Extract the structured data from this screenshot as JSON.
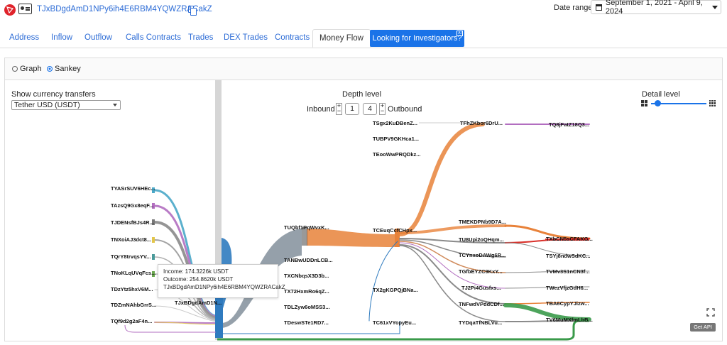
{
  "header": {
    "address": "TJxBDgdAmD1NPy6ih4E6RBM4YQWZRACakZ",
    "date_range_label": "Date range",
    "date_range_value": "September 1, 2021 - April 9, 2024"
  },
  "tabs": [
    {
      "label": "Address"
    },
    {
      "label": "Inflow"
    },
    {
      "label": "Outflow"
    },
    {
      "label": "Calls Contracts"
    },
    {
      "label": "Trades"
    },
    {
      "label": "DEX Trades"
    },
    {
      "label": "Contracts"
    },
    {
      "label": "Money Flow",
      "active": true
    }
  ],
  "investigators_button": {
    "label": "Looking for Investigators?",
    "badge": "AI"
  },
  "view_mode": {
    "graph_label": "Graph",
    "sankey_label": "Sankey",
    "selected": "Sankey"
  },
  "currency": {
    "label": "Show currency transfers",
    "selected": "Tether USD (USDT)"
  },
  "depth": {
    "label": "Depth level",
    "inbound_label": "Inbound",
    "outbound_label": "Outbound",
    "inbound_value": "1",
    "outbound_value": "4"
  },
  "detail": {
    "label": "Detail level",
    "level": 0.08
  },
  "nodes": {
    "tyas": "TYASrSUV6HEc...",
    "tazs": "TAzsQ9Gx8eqF...",
    "tjde": "TJDENsfBJs4R...",
    "tnxo": "TNXoiAJ3dct8...",
    "tqry": "TQrY8trvqsYV...",
    "tnok": "TNoKLqUVqFcs...",
    "tdzy": "TDzYtz5hxV6M...",
    "tdzm": "TDZmNAhbGrrS...",
    "tqf9": "TQf9d2g2aF4n...",
    "tjxb": "TJxBDgdAmD1N...",
    "tuqb": "TUQbf1PqWvxK...",
    "tanb": "TANBwUDDnLCB...",
    "txcn": "TXCNbqsX3D3b...",
    "tx72": "TX72HxmRo6qZ...",
    "tdlz": "TDLZyw6oMSS3...",
    "tdes": "TDeswSTe1RD7...",
    "tsgx": "TSgx2KuDBenZ...",
    "tubp": "TUBPV9GKHca1...",
    "teoo": "TEooWwPRQDkz...",
    "tceu": "TCEuqCcfCHpx...",
    "tx2g": "TX2gKGPQjBNa...",
    "tc61": "TC61xVYopyEu...",
    "tfhz": "TFhZKbor6DrU...",
    "tmek": "TMEKDPNb9D7A...",
    "tu8u": "TU8Upi2oQHqm...",
    "tcyn": "TCYnxoDAWg6R...",
    "tgfb": "TGfbEYZC9KxY...",
    "tj2p": "TJ2Pi4Gusfxs...",
    "tnfw": "TNFwdVPddCDf...",
    "tydq": "TYDqaTfNBLVu...",
    "tq8j": "TQ8jFatZ18Q3...",
    "txbc": "TXbCN5sCFAKG...",
    "tsyj": "TSYj8ndwSdKC...",
    "tvmv": "TVMv3S1nCN3f...",
    "twez": "TWezVfjzGdH6...",
    "tba6": "TBA6CypYJizw...",
    "tv6m": "TV6MuMXfmLbB..."
  },
  "tooltip": {
    "income": "Income: 174.3226k USDT",
    "outcome": "Outcome: 254.8620k USDT",
    "address": "TJxBDgdAmD1NPy6ih4E6RBM4YQWZRACakZ"
  },
  "api_button": "Get API",
  "colors": {
    "accent": "#1a73e8",
    "link": "#2d6cd6",
    "tron_red": "#e0232b",
    "flow_orange": "#e8823a",
    "flow_blue": "#2f7bbf",
    "flow_green": "#3a9a4a",
    "flow_purple": "#b26ec0",
    "flow_cyan": "#4aa8c8",
    "flow_gray": "#8a8a8a",
    "flow_red": "#d9302a"
  }
}
